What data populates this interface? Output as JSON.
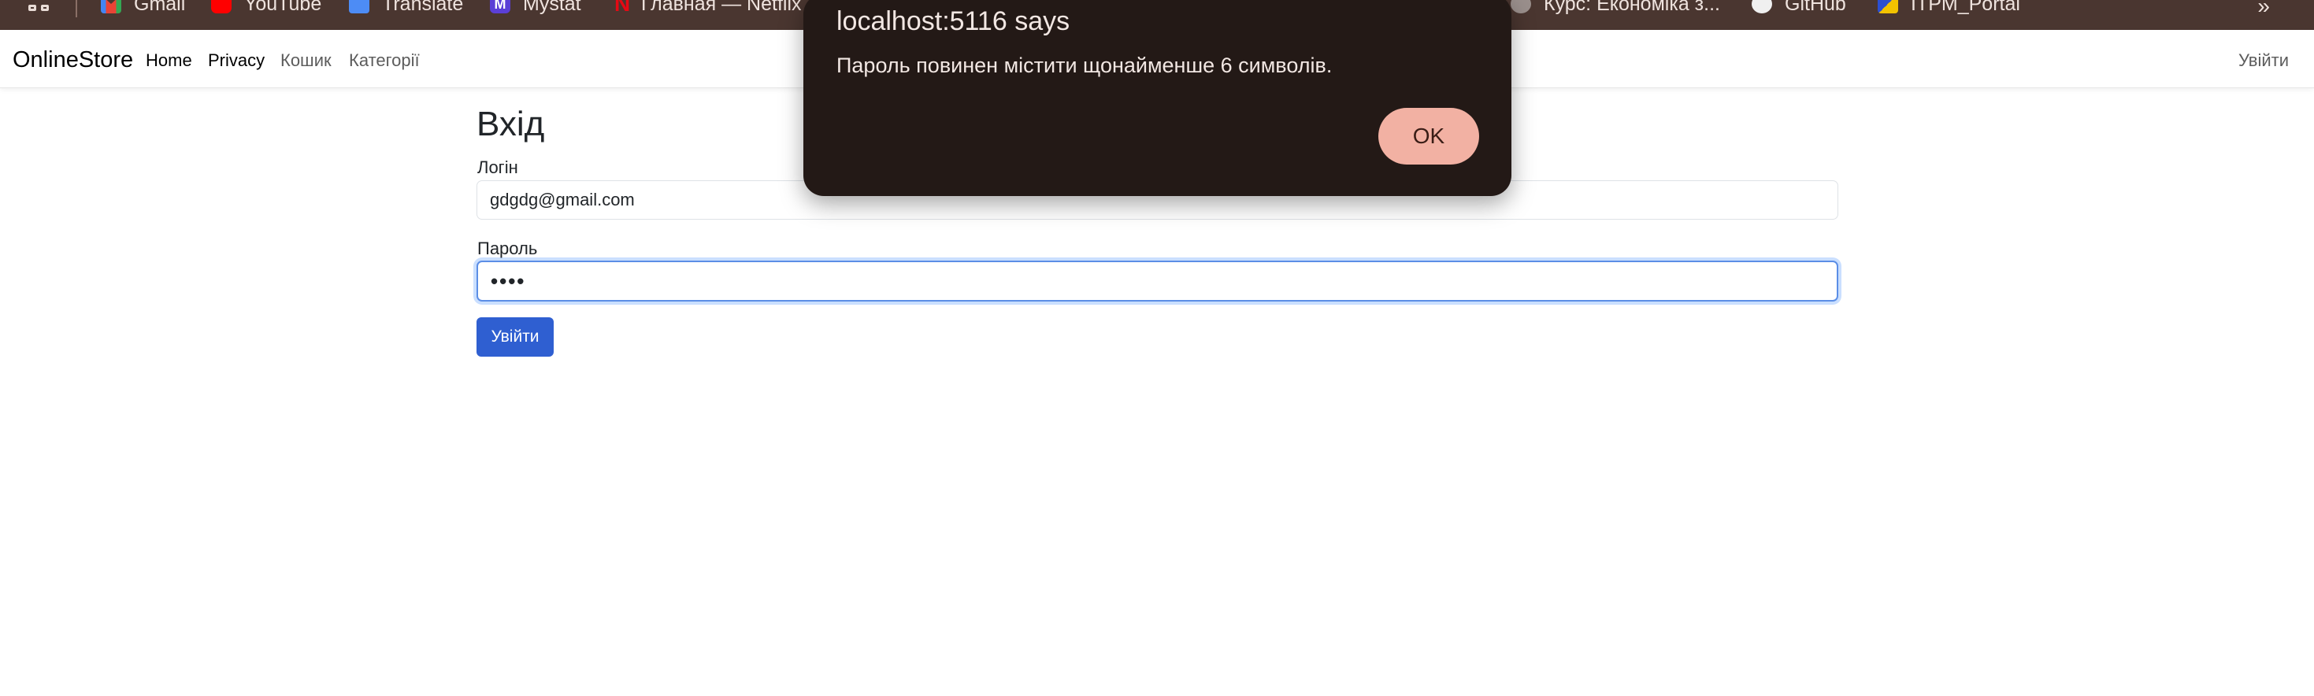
{
  "bookmarks": {
    "items": [
      {
        "label": "Gmail",
        "icon": "gmail-icon"
      },
      {
        "label": "YouTube",
        "icon": "youtube-icon"
      },
      {
        "label": "Translate",
        "icon": "translate-icon"
      },
      {
        "label": "Mystat",
        "icon": "mystat-icon",
        "icon_letter": "M"
      },
      {
        "label": "Главная — Netflix",
        "icon": "netflix-icon",
        "icon_letter": "N"
      },
      {
        "label": "Курс: Економіка з...",
        "icon": "globe-icon"
      },
      {
        "label": "GitHub",
        "icon": "github-icon"
      },
      {
        "label": "ITPM_Portal",
        "icon": "portal-icon"
      }
    ],
    "more": "»"
  },
  "navbar": {
    "brand": "OnlineStore",
    "links": [
      "Home",
      "Privacy",
      "Кошик",
      "Категорії"
    ],
    "login": "Увійти"
  },
  "form": {
    "title": "Вхід",
    "login_label": "Логін",
    "login_value": "gdgdg@gmail.com",
    "password_label": "Пароль",
    "password_value": "••••",
    "submit_label": "Увійти"
  },
  "alert": {
    "title": "localhost:5116 says",
    "message": "Пароль повинен містити щонайменше 6 символів.",
    "ok_label": "OK"
  },
  "colors": {
    "bookmarks_bg": "#4a3630",
    "primary_button": "#2f5fd1",
    "alert_bg": "#231916",
    "alert_ok": "#f2b1a3"
  }
}
